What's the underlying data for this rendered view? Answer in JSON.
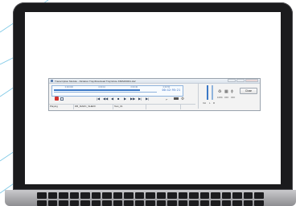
{
  "window": {
    "title": "Transcription Module - Dictation Tray\\Download Tray\\Voice K60Mrl0001.ds2"
  },
  "timeline": {
    "scale_labels": [
      "0:00:000",
      "0:00:10",
      "0:00:30",
      "0:00:50"
    ],
    "position_time": "00:42:95:21",
    "progress": 0.67
  },
  "controls": {
    "rec_icon": "record-icon",
    "speech_icon": "speech-recognition-icon",
    "transport": [
      "|◀",
      "◀◀",
      "◀",
      "■",
      "▶",
      "▶▶",
      "▶|",
      "▶|"
    ],
    "foot_icon": "footswitch-icon",
    "gear_icon": "gear-icon"
  },
  "status": {
    "state": "Playing",
    "file_name": "DB_MARC_SHEFF",
    "field3": "Test_01"
  },
  "side": {
    "vol_label": "Vol",
    "vol_l": "L",
    "vol_r": "R",
    "tools": [
      "♻",
      "▦",
      "ɸ"
    ],
    "tool_labels": [
      "100%",
      "OFF",
      "OFF"
    ],
    "close_label": "Close"
  },
  "colors": {
    "accent": "#3a78c7",
    "record": "#d5312c",
    "bezel": "#1b1b1d"
  }
}
